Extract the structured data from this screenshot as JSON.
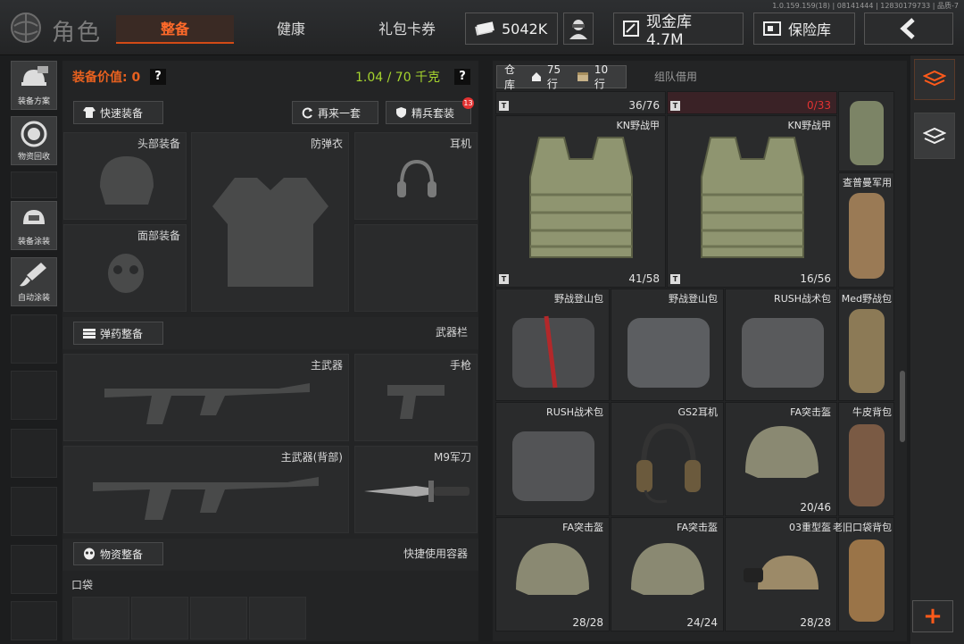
{
  "version": "1.0.159.159(18) | 08141444 | 12830179733 | 品质-7",
  "header": {
    "title": "角色",
    "tabs": [
      "整备",
      "健康",
      "礼包卡券"
    ],
    "active_tab": "整备",
    "coins": "5042K",
    "cash_label": "现金库 4.7M",
    "insurance_label": "保险库"
  },
  "left_rail": [
    {
      "label": "装备方案",
      "icon": "helmet-kit-icon"
    },
    {
      "label": "物资回收",
      "icon": "recycle-gasmask-icon"
    },
    {
      "label": "装备涂装",
      "icon": "paint-helmet-icon"
    },
    {
      "label": "自动涂装",
      "icon": "brush-icon"
    }
  ],
  "equipment": {
    "value_label": "装备价值: 0",
    "weight_label": "1.04 / 70 千克",
    "help": "?",
    "quick_equip": "快速装备",
    "again": "再来一套",
    "elite": "精兵套装",
    "elite_badge": "13",
    "slots": {
      "head": "头部装备",
      "armor": "防弹衣",
      "ear": "耳机",
      "face": "面部装备"
    },
    "ammo_button": "弹药整备",
    "weapon_section": "武器栏",
    "primary": "主武器",
    "pistol": "手枪",
    "primary_back": "主武器(背部)",
    "melee": "M9军刀",
    "supply_button": "物资整备",
    "quick_container": "快捷使用容器",
    "pocket": "口袋"
  },
  "inventory": {
    "warehouse_tab": "仓库",
    "rows": "75行",
    "slots": "10行",
    "team_tab": "组队借用",
    "top_counts": [
      "36/76",
      "0/33"
    ],
    "items": [
      {
        "name": "KN野战甲",
        "count": "41/58",
        "kind": "vest"
      },
      {
        "name": "KN野战甲",
        "count": "16/56",
        "kind": "vest"
      },
      {
        "name": "查普曼军用",
        "count": "",
        "kind": "pack-tan"
      },
      {
        "name": "野战登山包",
        "count": "",
        "kind": "bag-red"
      },
      {
        "name": "野战登山包",
        "count": "",
        "kind": "bag-grey"
      },
      {
        "name": "RUSH战术包",
        "count": "",
        "kind": "bag-grey"
      },
      {
        "name": "Med野战包",
        "count": "",
        "kind": "pack-tan"
      },
      {
        "name": "RUSH战术包",
        "count": "",
        "kind": "bag-grey"
      },
      {
        "name": "GS2耳机",
        "count": "",
        "kind": "headset"
      },
      {
        "name": "FA突击盔",
        "count": "20/46",
        "kind": "helmet"
      },
      {
        "name": "牛皮背包",
        "count": "",
        "kind": "pack-brown"
      },
      {
        "name": "FA突击盔",
        "count": "28/28",
        "kind": "helmet"
      },
      {
        "name": "FA突击盔",
        "count": "24/24",
        "kind": "helmet"
      },
      {
        "name": "03重型盔",
        "count": "28/28",
        "kind": "helmet-heavy"
      },
      {
        "name": "老旧口袋背包",
        "count": "",
        "kind": "pack-tan"
      }
    ]
  },
  "colors": {
    "accent": "#ff6a2a",
    "weight_ok": "#a6d42e",
    "danger": "#e23232"
  }
}
